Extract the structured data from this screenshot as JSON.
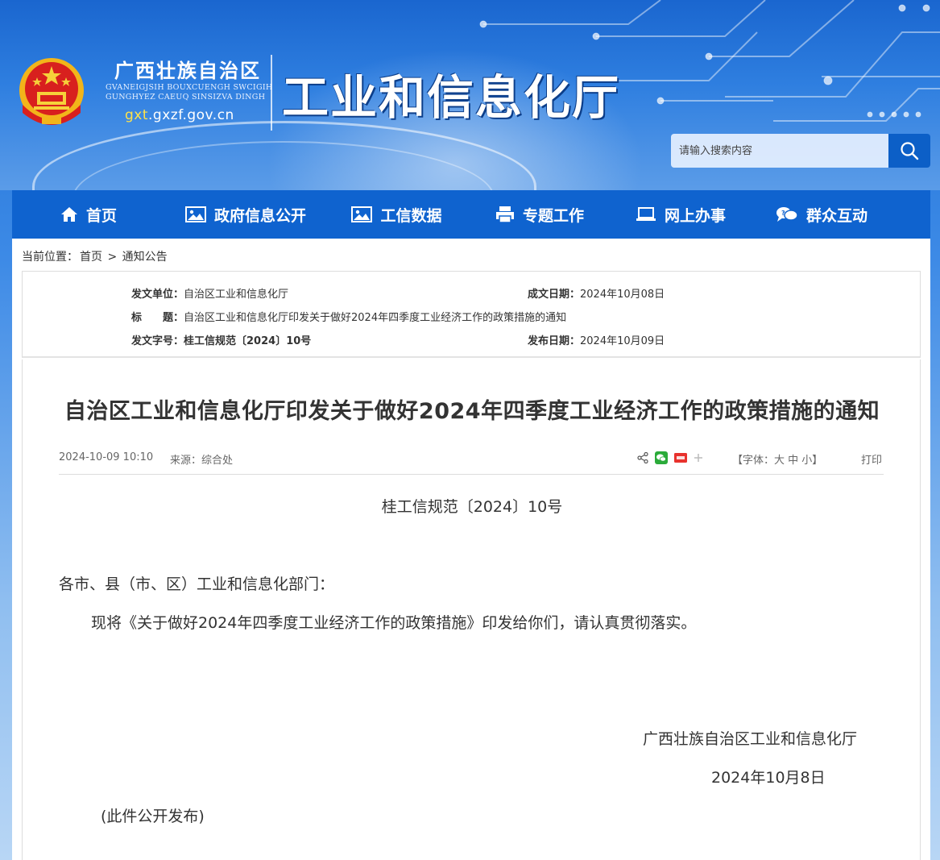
{
  "header": {
    "org_cn": "广西壮族自治区",
    "org_zhuang_1": "GVANEIGJSIH BOUXCUENGH SWCIGIH",
    "org_zhuang_2": "GUNGHYEZ CAEUQ SINSIZVA DINGH",
    "url_highlight": "gxt",
    "url_rest": ".gxzf.gov.cn",
    "dept_name": "工业和信息化厅",
    "search_placeholder": "请输入搜索内容",
    "icons": [
      "national-emblem-icon",
      "search-icon"
    ]
  },
  "nav": {
    "items": [
      {
        "label": "首页",
        "icon": "home-icon"
      },
      {
        "label": "政府信息公开",
        "icon": "image-icon"
      },
      {
        "label": "工信数据",
        "icon": "image-icon"
      },
      {
        "label": "专题工作",
        "icon": "printer-icon"
      },
      {
        "label": "网上办事",
        "icon": "laptop-icon"
      },
      {
        "label": "群众互动",
        "icon": "chat-icon"
      }
    ]
  },
  "breadcrumb": {
    "prefix": "当前位置：",
    "home": "首页",
    "sep": ">",
    "current": "通知公告"
  },
  "meta": {
    "issuer_label": "发文单位：",
    "issuer": "自治区工业和信息化厅",
    "created_label": "成文日期：",
    "created": "2024年10月08日",
    "title_label": "标　　题：",
    "title": "自治区工业和信息化厅印发关于做好2024年四季度工业经济工作的政策措施的通知",
    "docno_label": "发文字号：",
    "docno": "桂工信规范〔2024〕10号",
    "published_label": "发布日期：",
    "published": "2024年10月09日"
  },
  "article": {
    "title": "自治区工业和信息化厅印发关于做好2024年四季度工业经济工作的政策措施的通知",
    "datetime": "2024-10-09 10:10",
    "source": "来源：综合处",
    "share_icons": [
      "share-icon",
      "wechat-icon",
      "weibo-icon",
      "plus-icon"
    ],
    "font_size": "【字体：大 中 小】",
    "print": "打印",
    "doc_number": "桂工信规范〔2024〕10号",
    "salutation": "各市、县（市、区）工业和信息化部门：",
    "paragraph": "现将《关于做好2024年四季度工业经济工作的政策措施》印发给你们，请认真贯彻落实。",
    "signature_org": "广西壮族自治区工业和信息化厅",
    "signature_date": "2024年10月8日",
    "note": "(此件公开发布)"
  },
  "colors": {
    "nav_bg": "#0f63cf",
    "search_btn": "#0c5fc7",
    "url_highlight": "#ffe24a"
  }
}
